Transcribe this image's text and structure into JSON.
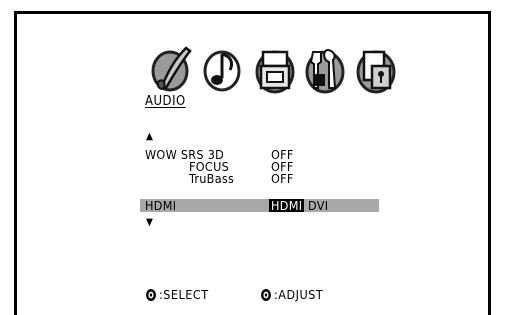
{
  "menu": {
    "icons": [
      "paintbrush-icon",
      "music-note-icon",
      "save-icon",
      "tools-icon",
      "lock-icon"
    ],
    "title": "AUDIO",
    "active_color": "#000000",
    "highlight_color": "#a8a8a8"
  },
  "settings": [
    {
      "label": "WOW SRS 3D",
      "value": "OFF"
    },
    {
      "label": "FOCUS",
      "value": "OFF"
    },
    {
      "label": "TruBass",
      "value": "OFF"
    }
  ],
  "hdmi": {
    "label": "HDMI",
    "options": [
      "HDMI",
      "DVI"
    ],
    "selected": "HDMI"
  },
  "footer": {
    "select_label": ":SELECT",
    "adjust_label": ":ADJUST"
  },
  "arrows": {
    "up": "▲",
    "down": "▼"
  }
}
